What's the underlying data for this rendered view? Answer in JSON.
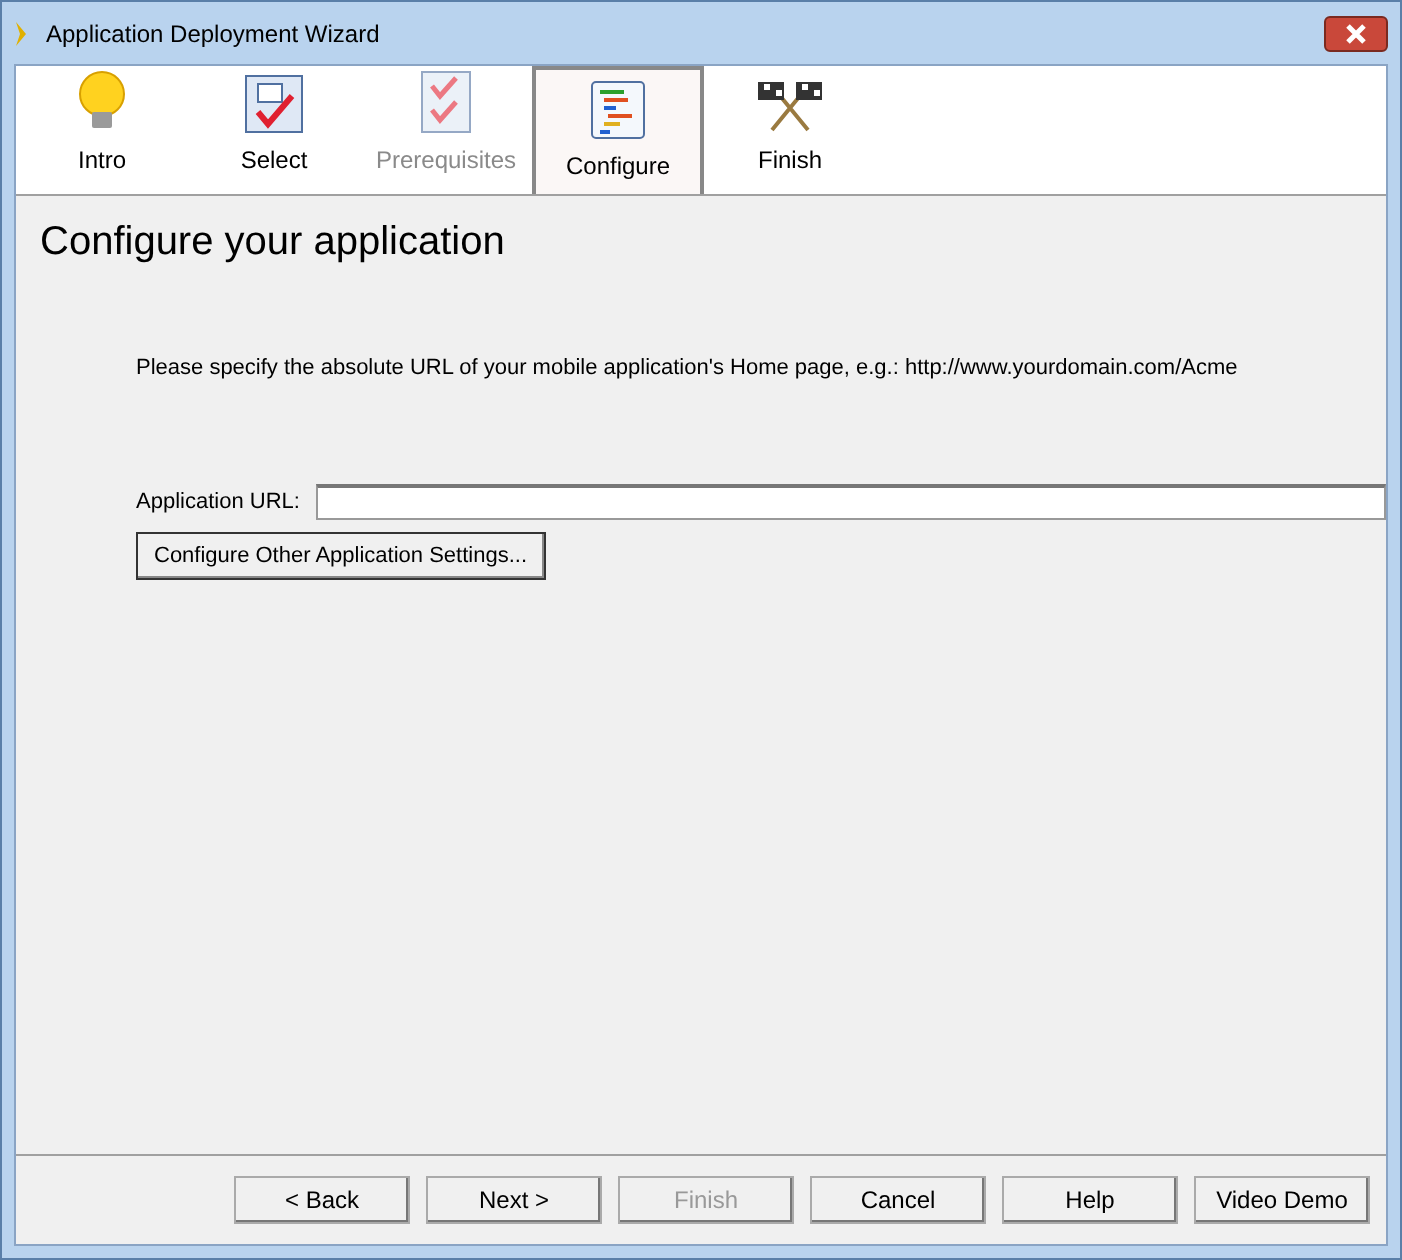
{
  "window": {
    "title": "Application Deployment Wizard"
  },
  "tabs": [
    {
      "label": "Intro",
      "kind": "bulb",
      "selected": false,
      "disabled": false
    },
    {
      "label": "Select",
      "kind": "check",
      "selected": false,
      "disabled": false
    },
    {
      "label": "Prerequisites",
      "kind": "checklist",
      "selected": false,
      "disabled": true
    },
    {
      "label": "Configure",
      "kind": "list",
      "selected": true,
      "disabled": false
    },
    {
      "label": "Finish",
      "kind": "flags",
      "selected": false,
      "disabled": false
    }
  ],
  "page": {
    "heading": "Configure your application",
    "instruction": "Please specify the absolute URL of your mobile application's Home page, e.g.: http://www.yourdomain.com/Acme",
    "url_label": "Application URL:",
    "settings_button": "Configure Other Application Settings..."
  },
  "buttons": [
    {
      "label": "< Back",
      "disabled": false
    },
    {
      "label": "Next >",
      "disabled": false
    },
    {
      "label": "Finish",
      "disabled": true
    },
    {
      "label": "Cancel",
      "disabled": false
    },
    {
      "label": "Help",
      "disabled": false
    },
    {
      "label": "Video Demo",
      "disabled": false
    }
  ]
}
